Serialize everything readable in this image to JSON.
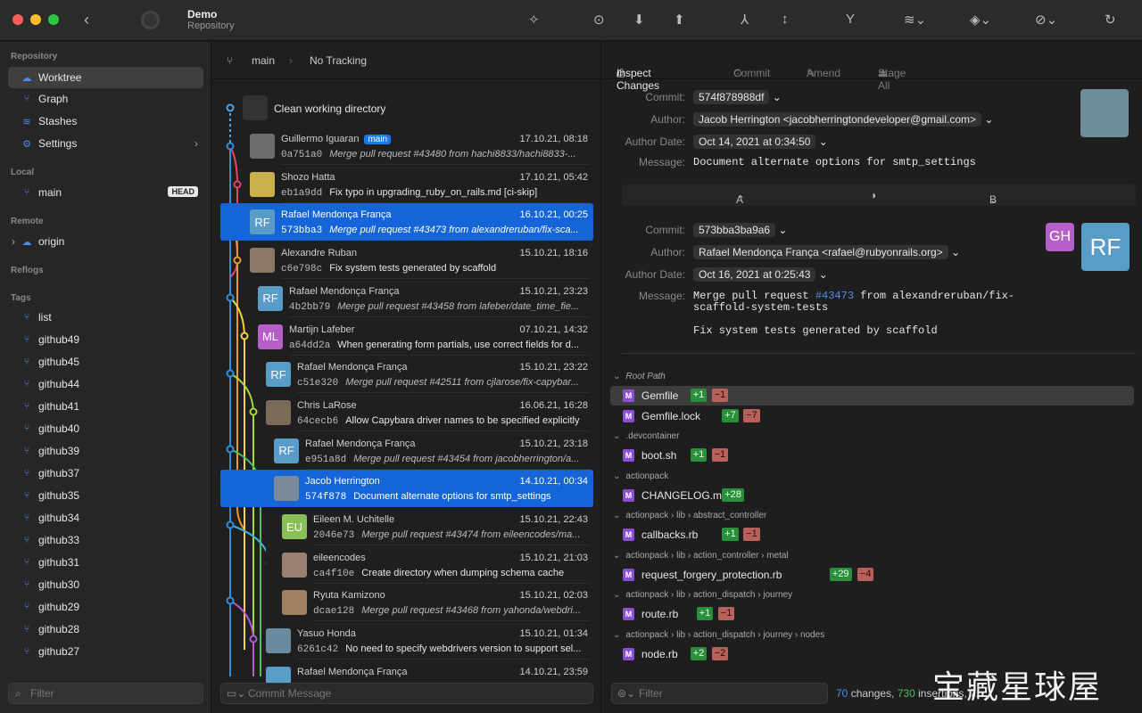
{
  "window": {
    "title": "Demo",
    "subtitle": "Repository"
  },
  "toolbar": {
    "icons": [
      "back-icon",
      "magic-icon",
      "fetch-icon",
      "pull-icon",
      "push-icon",
      "merge-icon",
      "split-icon",
      "branch-icon",
      "stash-icon",
      "layers-icon",
      "link-icon",
      "undo-icon"
    ]
  },
  "sidebar": {
    "repository_header": "Repository",
    "items": [
      {
        "label": "Worktree",
        "icon": "cloud-icon"
      },
      {
        "label": "Graph",
        "icon": "graph-icon"
      },
      {
        "label": "Stashes",
        "icon": "stash-icon"
      },
      {
        "label": "Settings",
        "icon": "gear-icon"
      }
    ],
    "local_header": "Local",
    "local_branch": "main",
    "head_badge": "HEAD",
    "remote_header": "Remote",
    "remote": "origin",
    "reflogs_header": "Reflogs",
    "tags_header": "Tags",
    "tags": [
      "list",
      "github49",
      "github45",
      "github44",
      "github41",
      "github40",
      "github39",
      "github37",
      "github35",
      "github34",
      "github33",
      "github31",
      "github30",
      "github29",
      "github28",
      "github27"
    ],
    "filter_placeholder": "Filter"
  },
  "history": {
    "branch": "main",
    "tracking": "No Tracking",
    "clean_label": "Clean working directory",
    "commits": [
      {
        "author": "Guillermo Iguaran",
        "date": "17.10.21, 08:18",
        "sha": "0a751a0",
        "message": "Merge pull request #43480 from hachi8833/hachi8833-...",
        "merge": true,
        "initials": "",
        "tag": "main"
      },
      {
        "author": "Shozo Hatta",
        "date": "17.10.21, 05:42",
        "sha": "eb1a9dd",
        "message": "Fix typo in upgrading_ruby_on_rails.md [ci-skip]",
        "merge": false,
        "initials": ""
      },
      {
        "author": "Rafael Mendonça França",
        "date": "16.10.21, 00:25",
        "sha": "573bba3",
        "message": "Merge pull request #43473 from alexandreruban/fix-sca...",
        "merge": true,
        "initials": "RF",
        "selected": true
      },
      {
        "author": "Alexandre Ruban",
        "date": "15.10.21, 18:16",
        "sha": "c6e798c",
        "message": "Fix system tests generated by scaffold",
        "merge": false,
        "initials": ""
      },
      {
        "author": "Rafael Mendonça França",
        "date": "15.10.21, 23:23",
        "sha": "4b2bb79",
        "message": "Merge pull request #43458 from lafeber/date_time_fie...",
        "merge": true,
        "initials": "RF"
      },
      {
        "author": "Martijn Lafeber",
        "date": "07.10.21, 14:32",
        "sha": "a64dd2a",
        "message": "When generating form partials, use correct fields for d...",
        "merge": false,
        "initials": "ML"
      },
      {
        "author": "Rafael Mendonça França",
        "date": "15.10.21, 23:22",
        "sha": "c51e320",
        "message": "Merge pull request #42511 from cjlarose/fix-capybar...",
        "merge": true,
        "initials": "RF"
      },
      {
        "author": "Chris LaRose",
        "date": "16.06.21, 16:28",
        "sha": "64cecb6",
        "message": "Allow Capybara driver names to be specified explicitly",
        "merge": false,
        "initials": ""
      },
      {
        "author": "Rafael Mendonça França",
        "date": "15.10.21, 23:18",
        "sha": "e951a8d",
        "message": "Merge pull request #43454 from jacobherrington/a...",
        "merge": true,
        "initials": "RF"
      },
      {
        "author": "Jacob Herrington",
        "date": "14.10.21, 00:34",
        "sha": "574f878",
        "message": "Document alternate options for smtp_settings",
        "merge": false,
        "initials": "",
        "selected": true
      },
      {
        "author": "Eileen M. Uchitelle",
        "date": "15.10.21, 22:43",
        "sha": "2046e73",
        "message": "Merge pull request #43474 from eileencodes/ma...",
        "merge": true,
        "initials": "EU"
      },
      {
        "author": "eileencodes",
        "date": "15.10.21, 21:03",
        "sha": "ca4f10e",
        "message": "Create directory when dumping schema cache",
        "merge": false,
        "initials": ""
      },
      {
        "author": "Ryuta Kamizono",
        "date": "15.10.21, 02:03",
        "sha": "dcae128",
        "message": "Merge pull request #43468 from yahonda/webdri...",
        "merge": true,
        "initials": ""
      },
      {
        "author": "Yasuo Honda",
        "date": "15.10.21, 01:34",
        "sha": "6261c42",
        "message": "No need to specify webdrivers version to support sel...",
        "merge": false,
        "initials": ""
      },
      {
        "author": "Rafael Mendonça França",
        "date": "14.10.21, 23:59",
        "sha": "",
        "message": "",
        "merge": false,
        "initials": ""
      }
    ],
    "commit_placeholder": "Commit Message"
  },
  "inspector": {
    "tabs": [
      "Inspect Changes",
      "Commit",
      "Amend",
      "Stage All"
    ],
    "a": {
      "commit_label": "Commit:",
      "commit": "574f878988df",
      "author_label": "Author:",
      "author": "Jacob Herrington <jacobherringtondeveloper@gmail.com>",
      "date_label": "Author Date:",
      "date": "Oct 14, 2021 at 0:34:50",
      "message_label": "Message:",
      "message": "Document alternate options for smtp_settings"
    },
    "ab": {
      "a": "A",
      "b": "B"
    },
    "b": {
      "commit_label": "Commit:",
      "commit": "573bba3ba9a6",
      "author_label": "Author:",
      "author": "Rafael Mendonça França <rafael@rubyonrails.org>",
      "date_label": "Author Date:",
      "date": "Oct 16, 2021 at 0:25:43",
      "message_label": "Message:",
      "message_l1_pre": "Merge pull request ",
      "message_l1_link": "#43473",
      "message_l1_post": " from alexandreruban/fix-",
      "message_l2": "scaffold-system-tests",
      "message_l3": "Fix system tests generated by scaffold",
      "gh": "GH",
      "rf": "RF"
    },
    "groups": [
      {
        "path": "Root Path",
        "italic": true,
        "files": [
          {
            "name": "Gemfile",
            "add": "+1",
            "del": "−1",
            "hl": true
          },
          {
            "name": "Gemfile.lock",
            "add": "+7",
            "del": "−7"
          }
        ]
      },
      {
        "path": ".devcontainer",
        "files": [
          {
            "name": "boot.sh",
            "add": "+1",
            "del": "−1"
          }
        ]
      },
      {
        "path": "actionpack",
        "files": [
          {
            "name": "CHANGELOG.md",
            "add": "+28",
            "del": ""
          }
        ]
      },
      {
        "path": "actionpack › lib › abstract_controller",
        "files": [
          {
            "name": "callbacks.rb",
            "add": "+1",
            "del": "−1"
          }
        ]
      },
      {
        "path": "actionpack › lib › action_controller › metal",
        "files": [
          {
            "name": "request_forgery_protection.rb",
            "add": "+29",
            "del": "−4"
          }
        ]
      },
      {
        "path": "actionpack › lib › action_dispatch › journey",
        "files": [
          {
            "name": "route.rb",
            "add": "+1",
            "del": "−1"
          }
        ]
      },
      {
        "path": "actionpack › lib › action_dispatch › journey › nodes",
        "files": [
          {
            "name": "node.rb",
            "add": "+2",
            "del": "−2"
          }
        ]
      }
    ],
    "filter_placeholder": "Filter",
    "status": {
      "changes": "70",
      "changes_label": " changes, ",
      "insertions": "730",
      "insertions_label": " insertions, 7..."
    }
  },
  "watermark": "宝藏星球屋",
  "colors": {
    "accent": "#1565d8",
    "add": "#2a8f3a",
    "del": "#b8605a",
    "modified": "#8b4fd6"
  }
}
